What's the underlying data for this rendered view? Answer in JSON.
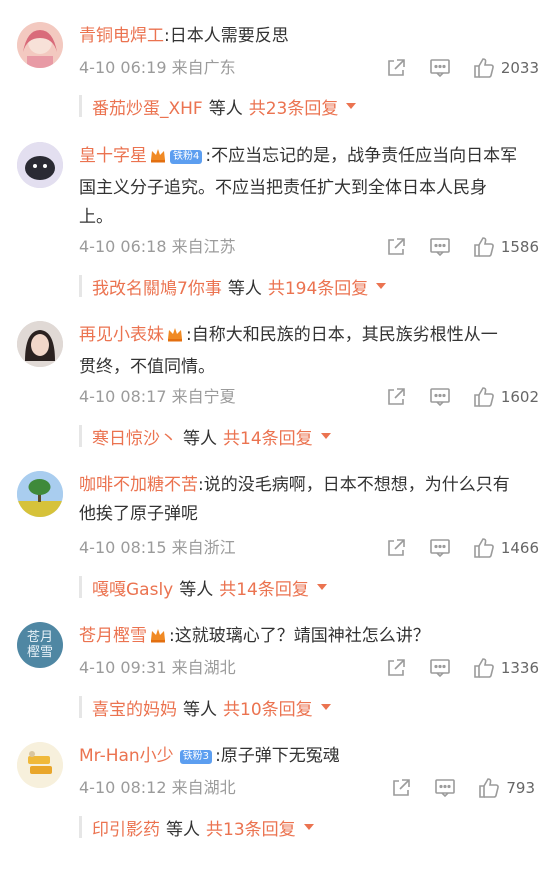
{
  "comments": [
    {
      "username": "青铜电焊工",
      "text_lines": [
        ":日本人需要反思"
      ],
      "time": "4-10 06:19",
      "location": "来自广东",
      "likes": "2033",
      "reply": {
        "user": "番茄炒蛋_XHF",
        "etc": "等人",
        "total": "共23条回复"
      }
    },
    {
      "username": "皇十字星",
      "fan_badge": "铁粉4",
      "text_lines": [
        ":不应当忘记的是，战争责任应当向日本军",
        "国主义分子追究。不应当把责任扩大到全体日本人民身",
        "上。"
      ],
      "time": "4-10 06:18",
      "location": "来自江苏",
      "likes": "1586",
      "reply": {
        "user": "我改名關鳩7你事",
        "etc": "等人",
        "total": "共194条回复"
      }
    },
    {
      "username": "再见小表妹",
      "text_lines": [
        ":自称大和民族的日本，其民族劣根性从一",
        "贯终，不值同情。"
      ],
      "time": "4-10 08:17",
      "location": "来自宁夏",
      "likes": "1602",
      "reply": {
        "user": "寒日惊沙丶",
        "etc": "等人",
        "total": "共14条回复"
      }
    },
    {
      "username": "咖啡不加糖不苦",
      "text_lines": [
        ":说的没毛病啊，日本不想想，为什么只有",
        "他挨了原子弹呢"
      ],
      "time": "4-10 08:15",
      "location": "来自浙江",
      "likes": "1466",
      "reply": {
        "user": "嘎嘎Gasly",
        "etc": "等人",
        "total": "共14条回复"
      }
    },
    {
      "username": "苍月樫雪",
      "avatar_text": "苍月樫雪",
      "text_lines": [
        ":这就玻璃心了？靖国神社怎么讲？"
      ],
      "time": "4-10 09:31",
      "location": "来自湖北",
      "likes": "1336",
      "reply": {
        "user": "喜宝的妈妈",
        "etc": "等人",
        "total": "共10条回复"
      }
    },
    {
      "username": "Mr-Han小少",
      "fan_badge": "铁粉3",
      "text_lines": [
        ":原子弹下无冤魂"
      ],
      "time": "4-10 08:12",
      "location": "来自湖北",
      "likes": "793",
      "reply": {
        "user": "印引影药",
        "etc": "等人",
        "total": "共13条回复"
      }
    }
  ],
  "colors": {
    "username": "#eb7350",
    "meta": "#9b9b9b",
    "text": "#333333",
    "fan_badge": "#5c9ef0"
  },
  "icons": [
    "share-icon",
    "comment-icon",
    "like-icon",
    "crown-badge-icon",
    "dropdown-triangle-icon"
  ]
}
